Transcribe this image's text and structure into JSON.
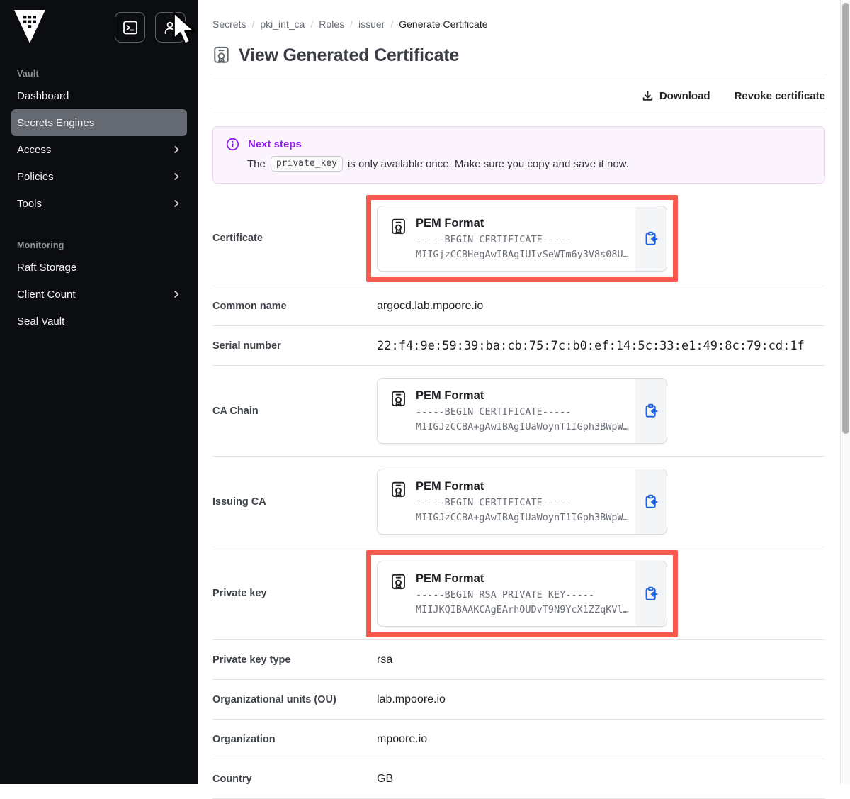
{
  "sidebar": {
    "sections": [
      {
        "label": "Vault",
        "items": [
          {
            "label": "Dashboard"
          },
          {
            "label": "Secrets Engines"
          },
          {
            "label": "Access"
          },
          {
            "label": "Policies"
          },
          {
            "label": "Tools"
          }
        ]
      },
      {
        "label": "Monitoring",
        "items": [
          {
            "label": "Raft Storage"
          },
          {
            "label": "Client Count"
          },
          {
            "label": "Seal Vault"
          }
        ]
      }
    ],
    "icons": [
      "vault-logo",
      "terminal-icon",
      "person-icon"
    ]
  },
  "breadcrumb": {
    "separator": "/",
    "items": [
      "Secrets",
      "pki_int_ca",
      "Roles",
      "issuer",
      "Generate Certificate"
    ]
  },
  "header": {
    "title": "View Generated Certificate",
    "icon": "certificate-icon"
  },
  "toolbar": {
    "download_label": "Download",
    "revoke_label": "Revoke certificate"
  },
  "alert": {
    "title": "Next steps",
    "text_before": "The",
    "code": "private_key",
    "text_after": "is only available once. Make sure you copy and save it now."
  },
  "fields": {
    "rows": [
      {
        "type": "pem",
        "label": "Certificate",
        "highlighted": true,
        "pem": {
          "title": "PEM Format",
          "line1": "-----BEGIN CERTIFICATE-----",
          "line2": "MIIGjzCCBHegAwIBAgIUIvSeWTm6y3V8s08U…"
        }
      },
      {
        "type": "text",
        "label": "Common name",
        "value": "argocd.lab.mpoore.io"
      },
      {
        "type": "mono",
        "label": "Serial number",
        "value": "22:f4:9e:59:39:ba:cb:75:7c:b0:ef:14:5c:33:e1:49:8c:79:cd:1f"
      },
      {
        "type": "pem",
        "label": "CA Chain",
        "highlighted": false,
        "pem": {
          "title": "PEM Format",
          "line1": "-----BEGIN CERTIFICATE-----",
          "line2": "MIIGJzCCBA+gAwIBAgIUaWoynT1IGph3BWpW…"
        }
      },
      {
        "type": "pem",
        "label": "Issuing CA",
        "highlighted": false,
        "pem": {
          "title": "PEM Format",
          "line1": "-----BEGIN CERTIFICATE-----",
          "line2": "MIIGJzCCBA+gAwIBAgIUaWoynT1IGph3BWpW…"
        }
      },
      {
        "type": "pem",
        "label": "Private key",
        "highlighted": true,
        "pem": {
          "title": "PEM Format",
          "line1": "-----BEGIN RSA PRIVATE KEY-----",
          "line2": "MIIJKQIBAAKCAgEArhOUDvT9N9YcX1ZZqKVl…"
        }
      },
      {
        "type": "text",
        "label": "Private key type",
        "value": "rsa"
      },
      {
        "type": "text",
        "label": "Organizational units (OU)",
        "value": "lab.mpoore.io"
      },
      {
        "type": "text",
        "label": "Organization",
        "value": "mpoore.io"
      },
      {
        "type": "text",
        "label": "Country",
        "value": "GB"
      }
    ]
  },
  "colors": {
    "sidebar_bg": "#0c0d11",
    "sidebar_selected": "#656a72",
    "accent_purple": "#911ced",
    "annotation_red": "#f8584d",
    "copy_icon_blue": "#1b64e6",
    "alert_bg": "#fbf4fd"
  }
}
